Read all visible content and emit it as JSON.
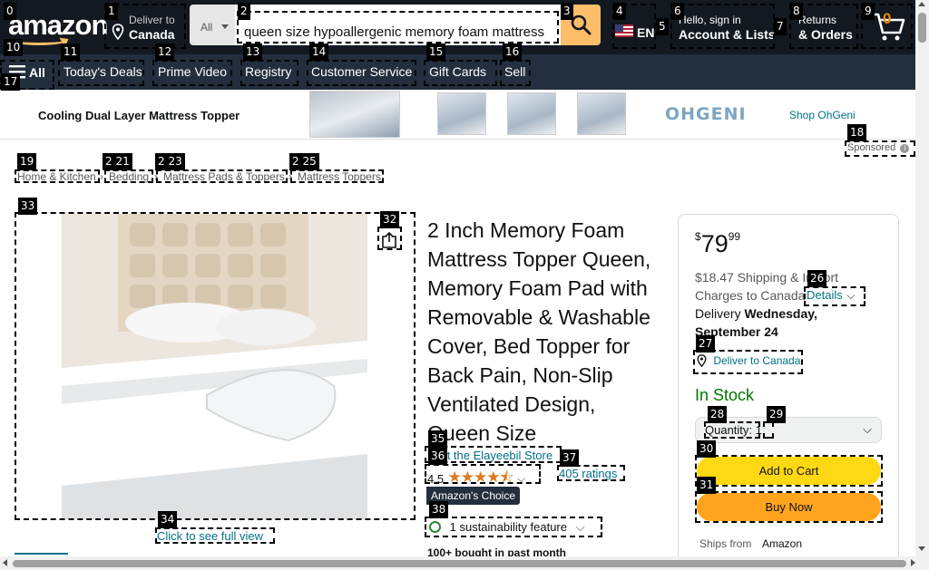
{
  "header": {
    "logo": "amazon",
    "deliver_label": "Deliver to",
    "deliver_location": "Canada",
    "search_category": "All",
    "search_value": "queen size hypoallergenic memory foam mattress",
    "language": "EN",
    "signin_line1": "Hello, sign in",
    "signin_line2": "Account & Lists",
    "returns_line1": "Returns",
    "returns_line2": "& Orders",
    "cart_count": "0"
  },
  "nav": {
    "all_label": "All",
    "links": [
      "Today's Deals",
      "Prime Video",
      "Registry",
      "Customer Service",
      "Gift Cards",
      "Sell"
    ]
  },
  "banner": {
    "title": "Cooling Dual Layer Mattress Topper",
    "brand": "OHGENI",
    "shop_link": "Shop OhGeni",
    "sponsored": "Sponsored"
  },
  "breadcrumbs": [
    "Home & Kitchen",
    "Bedding",
    "Mattress Pads & Toppers",
    "Mattress Toppers"
  ],
  "product": {
    "title": "2 Inch Memory Foam Mattress Topper Queen, Memory Foam Pad with Removable & Washable Cover, Bed Topper for Back Pain, Non-Slip Ventilated Design, Queen Size",
    "store_link": "Visit the Elayeebil Store",
    "rating_value": "4.5",
    "ratings_count": "405 ratings",
    "choice_badge": "Amazon's Choice",
    "sustainability": "1 sustainability feature",
    "bought": "100+ bought in past month",
    "full_view_link": "Click to see full view"
  },
  "buybox": {
    "price_symbol": "$",
    "price_whole": "79",
    "price_fraction": "99",
    "shipping": "$18.47 Shipping & Import Charges to Canada",
    "details_link": "Details",
    "delivery_prefix": "Delivery",
    "delivery_date": "Wednesday, September 24",
    "deliver_to_link": "Deliver to Canada",
    "stock": "In Stock",
    "quantity_label": "Quantity:",
    "quantity_value": "1",
    "add_to_cart": "Add to Cart",
    "buy_now": "Buy Now",
    "ships_from_label": "Ships from",
    "ships_from_value": "Amazon"
  },
  "labels": [
    "0",
    "1",
    "2",
    "3",
    "4",
    "5",
    "6",
    "7",
    "8",
    "9",
    "10",
    "11",
    "12",
    "13",
    "14",
    "15",
    "16",
    "17",
    "18",
    "19",
    "2 21",
    "2 23",
    "2 25",
    "26",
    "27",
    "28",
    "29",
    "30",
    "31",
    "32",
    "33",
    "34",
    "35",
    "36",
    "37",
    "38"
  ],
  "colors": {
    "header_bg": "#131921",
    "nav_bg": "#232f3e",
    "accent": "#febd69",
    "add_to_cart": "#ffd814",
    "buy_now": "#ffa41c",
    "in_stock": "#007600",
    "link": "#007185",
    "star": "#de7921"
  }
}
